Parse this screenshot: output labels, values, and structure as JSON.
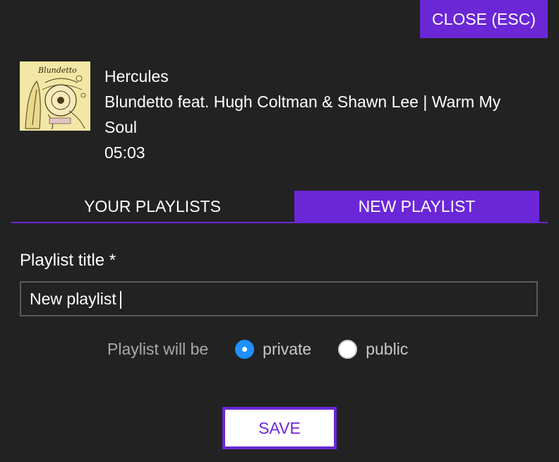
{
  "close_button": {
    "label": "CLOSE (ESC)"
  },
  "track": {
    "title": "Hercules",
    "artist_album": "Blundetto feat. Hugh Coltman & Shawn Lee | Warm My Soul",
    "duration": "05:03",
    "cover_logo_text": "Blundetto"
  },
  "tabs": [
    {
      "label": "YOUR PLAYLISTS",
      "active": false
    },
    {
      "label": "NEW PLAYLIST",
      "active": true
    }
  ],
  "form": {
    "title_label": "Playlist title *",
    "title_value": "New playlist",
    "visibility_label": "Playlist will be",
    "options": [
      {
        "label": "private",
        "selected": true
      },
      {
        "label": "public",
        "selected": false
      }
    ],
    "save_label": "SAVE"
  },
  "colors": {
    "accent": "#6b27d6",
    "background": "#222222",
    "radio_selected": "#1e90ff"
  }
}
